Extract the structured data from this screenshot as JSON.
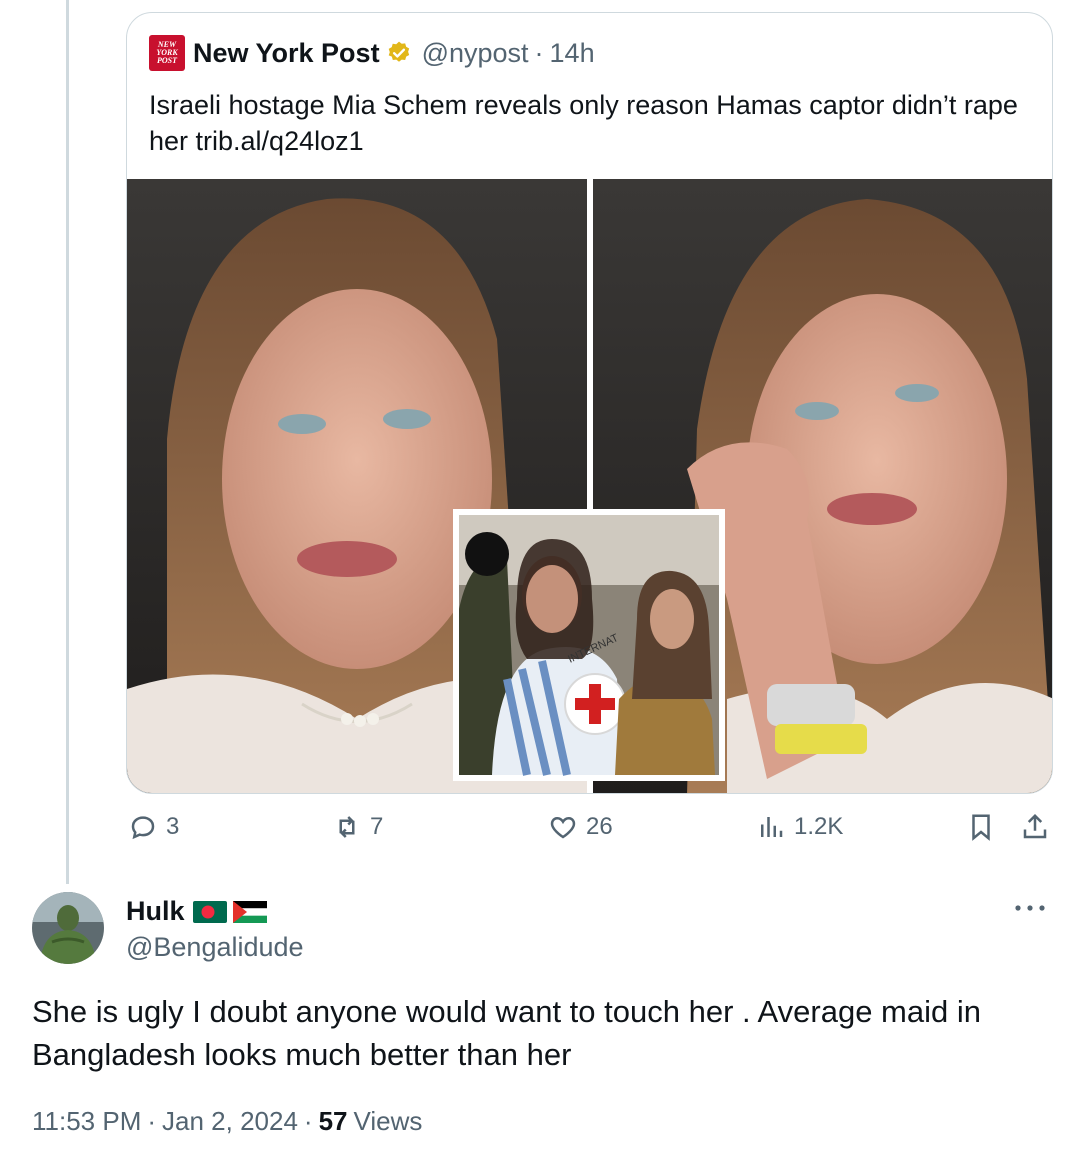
{
  "quoted_tweet": {
    "logo_lines": [
      "NEW",
      "YORK",
      "POST"
    ],
    "author_name": "New York Post",
    "handle": "@nypost",
    "separator": "·",
    "time": "14h",
    "text": "Israeli hostage Mia Schem reveals only reason Hamas captor didn’t rape her trib.al/q24loz1",
    "inset_text": "INTERNAT"
  },
  "actions": {
    "replies": "3",
    "reposts": "7",
    "likes": "26",
    "views": "1.2K"
  },
  "reply": {
    "name": "Hulk",
    "handle": "@Bengalidude",
    "text": "She is ugly I doubt anyone would want to touch her . Average maid in Bangladesh looks much better than her",
    "time": "11:53 PM",
    "date": "Jan 2, 2024",
    "views_count": "57",
    "views_label": "Views",
    "separator": "·"
  },
  "colors": {
    "text": "#0f1419",
    "secondary": "#536471",
    "border": "#cfd9de",
    "verified_gold": "#e2b719",
    "nypost_red": "#c8102e"
  },
  "icons": [
    "verified-badge-icon",
    "reply-icon",
    "repost-icon",
    "like-icon",
    "views-icon",
    "bookmark-icon",
    "share-icon",
    "more-icon"
  ]
}
